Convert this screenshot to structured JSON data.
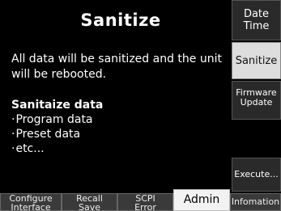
{
  "title": "Sanitize",
  "message": "All data will be sanitized and the unit will be rebooted.",
  "section": {
    "heading": "Sanitaize data",
    "items": [
      "Program data",
      "Preset data",
      "etc..."
    ]
  },
  "softkeys": {
    "date_time": "Date Time",
    "sanitize": "Sanitize",
    "firmware_update": "Firmware Update",
    "execute": "Execute..."
  },
  "tabs": {
    "configure": "Configure Interface",
    "recall": "Recall Save",
    "scpi": "SCPI Error",
    "admin": "Admin",
    "information": "Infomation"
  }
}
